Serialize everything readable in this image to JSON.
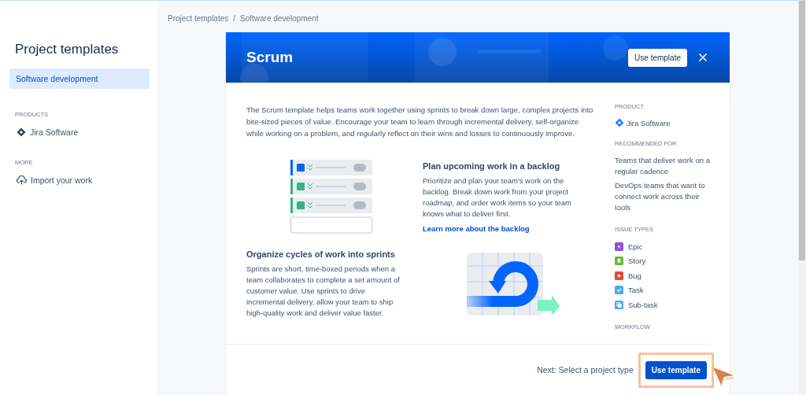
{
  "sidebar": {
    "title": "Project templates",
    "items": [
      {
        "label": "Software development",
        "selected": true
      }
    ],
    "sections": [
      {
        "heading": "PRODUCTS",
        "items": [
          {
            "label": "Jira Software",
            "kind": "product"
          }
        ]
      },
      {
        "heading": "MORE",
        "items": [
          {
            "label": "Import your work",
            "kind": "import"
          }
        ]
      }
    ]
  },
  "breadcrumbs": [
    "Project templates",
    "Software development"
  ],
  "breadcrumb_separator": "/",
  "modal": {
    "title": "Scrum",
    "header_button": "Use template",
    "description": "The Scrum template helps teams work together using sprints to break down large, complex projects into bite-sized pieces of value. Encourage your team to learn through incremental delivery, self-organize while working on a problem, and regularly reflect on their wins and losses to continuously improve.",
    "features": [
      {
        "kind": "backlog",
        "title": "Plan upcoming work in a backlog",
        "text": "Prioritize and plan your team's work on the backlog. Break down work from your project roadmap, and order work items so your team knows what to deliver first.",
        "link": "Learn more about the backlog"
      },
      {
        "kind": "sprint",
        "title": "Organize cycles of work into sprints",
        "text": "Sprints are short, time-boxed periods when a team collaborates to complete a set amount of customer value. Use sprints to drive incremental delivery, allow your team to ship high-quality work and deliver value faster."
      }
    ],
    "side": {
      "product_heading": "PRODUCT",
      "product": "Jira Software",
      "recommended_heading": "RECOMMENDED FOR",
      "recommended": [
        "Teams that deliver work on a regular cadence",
        "DevOps teams that want to connect work across their tools"
      ],
      "issue_types_heading": "ISSUE TYPES",
      "issue_types": [
        {
          "label": "Epic",
          "kind": "epic",
          "color": "#904ee2"
        },
        {
          "label": "Story",
          "kind": "story",
          "color": "#63ba3c"
        },
        {
          "label": "Bug",
          "kind": "bug",
          "color": "#e5493a"
        },
        {
          "label": "Task",
          "kind": "task",
          "color": "#4bade8"
        },
        {
          "label": "Sub-task",
          "kind": "subtask",
          "color": "#4bade8"
        }
      ],
      "workflow_heading": "WORKFLOW"
    },
    "footer_text": "Next: Select a project type",
    "footer_button": "Use template"
  }
}
